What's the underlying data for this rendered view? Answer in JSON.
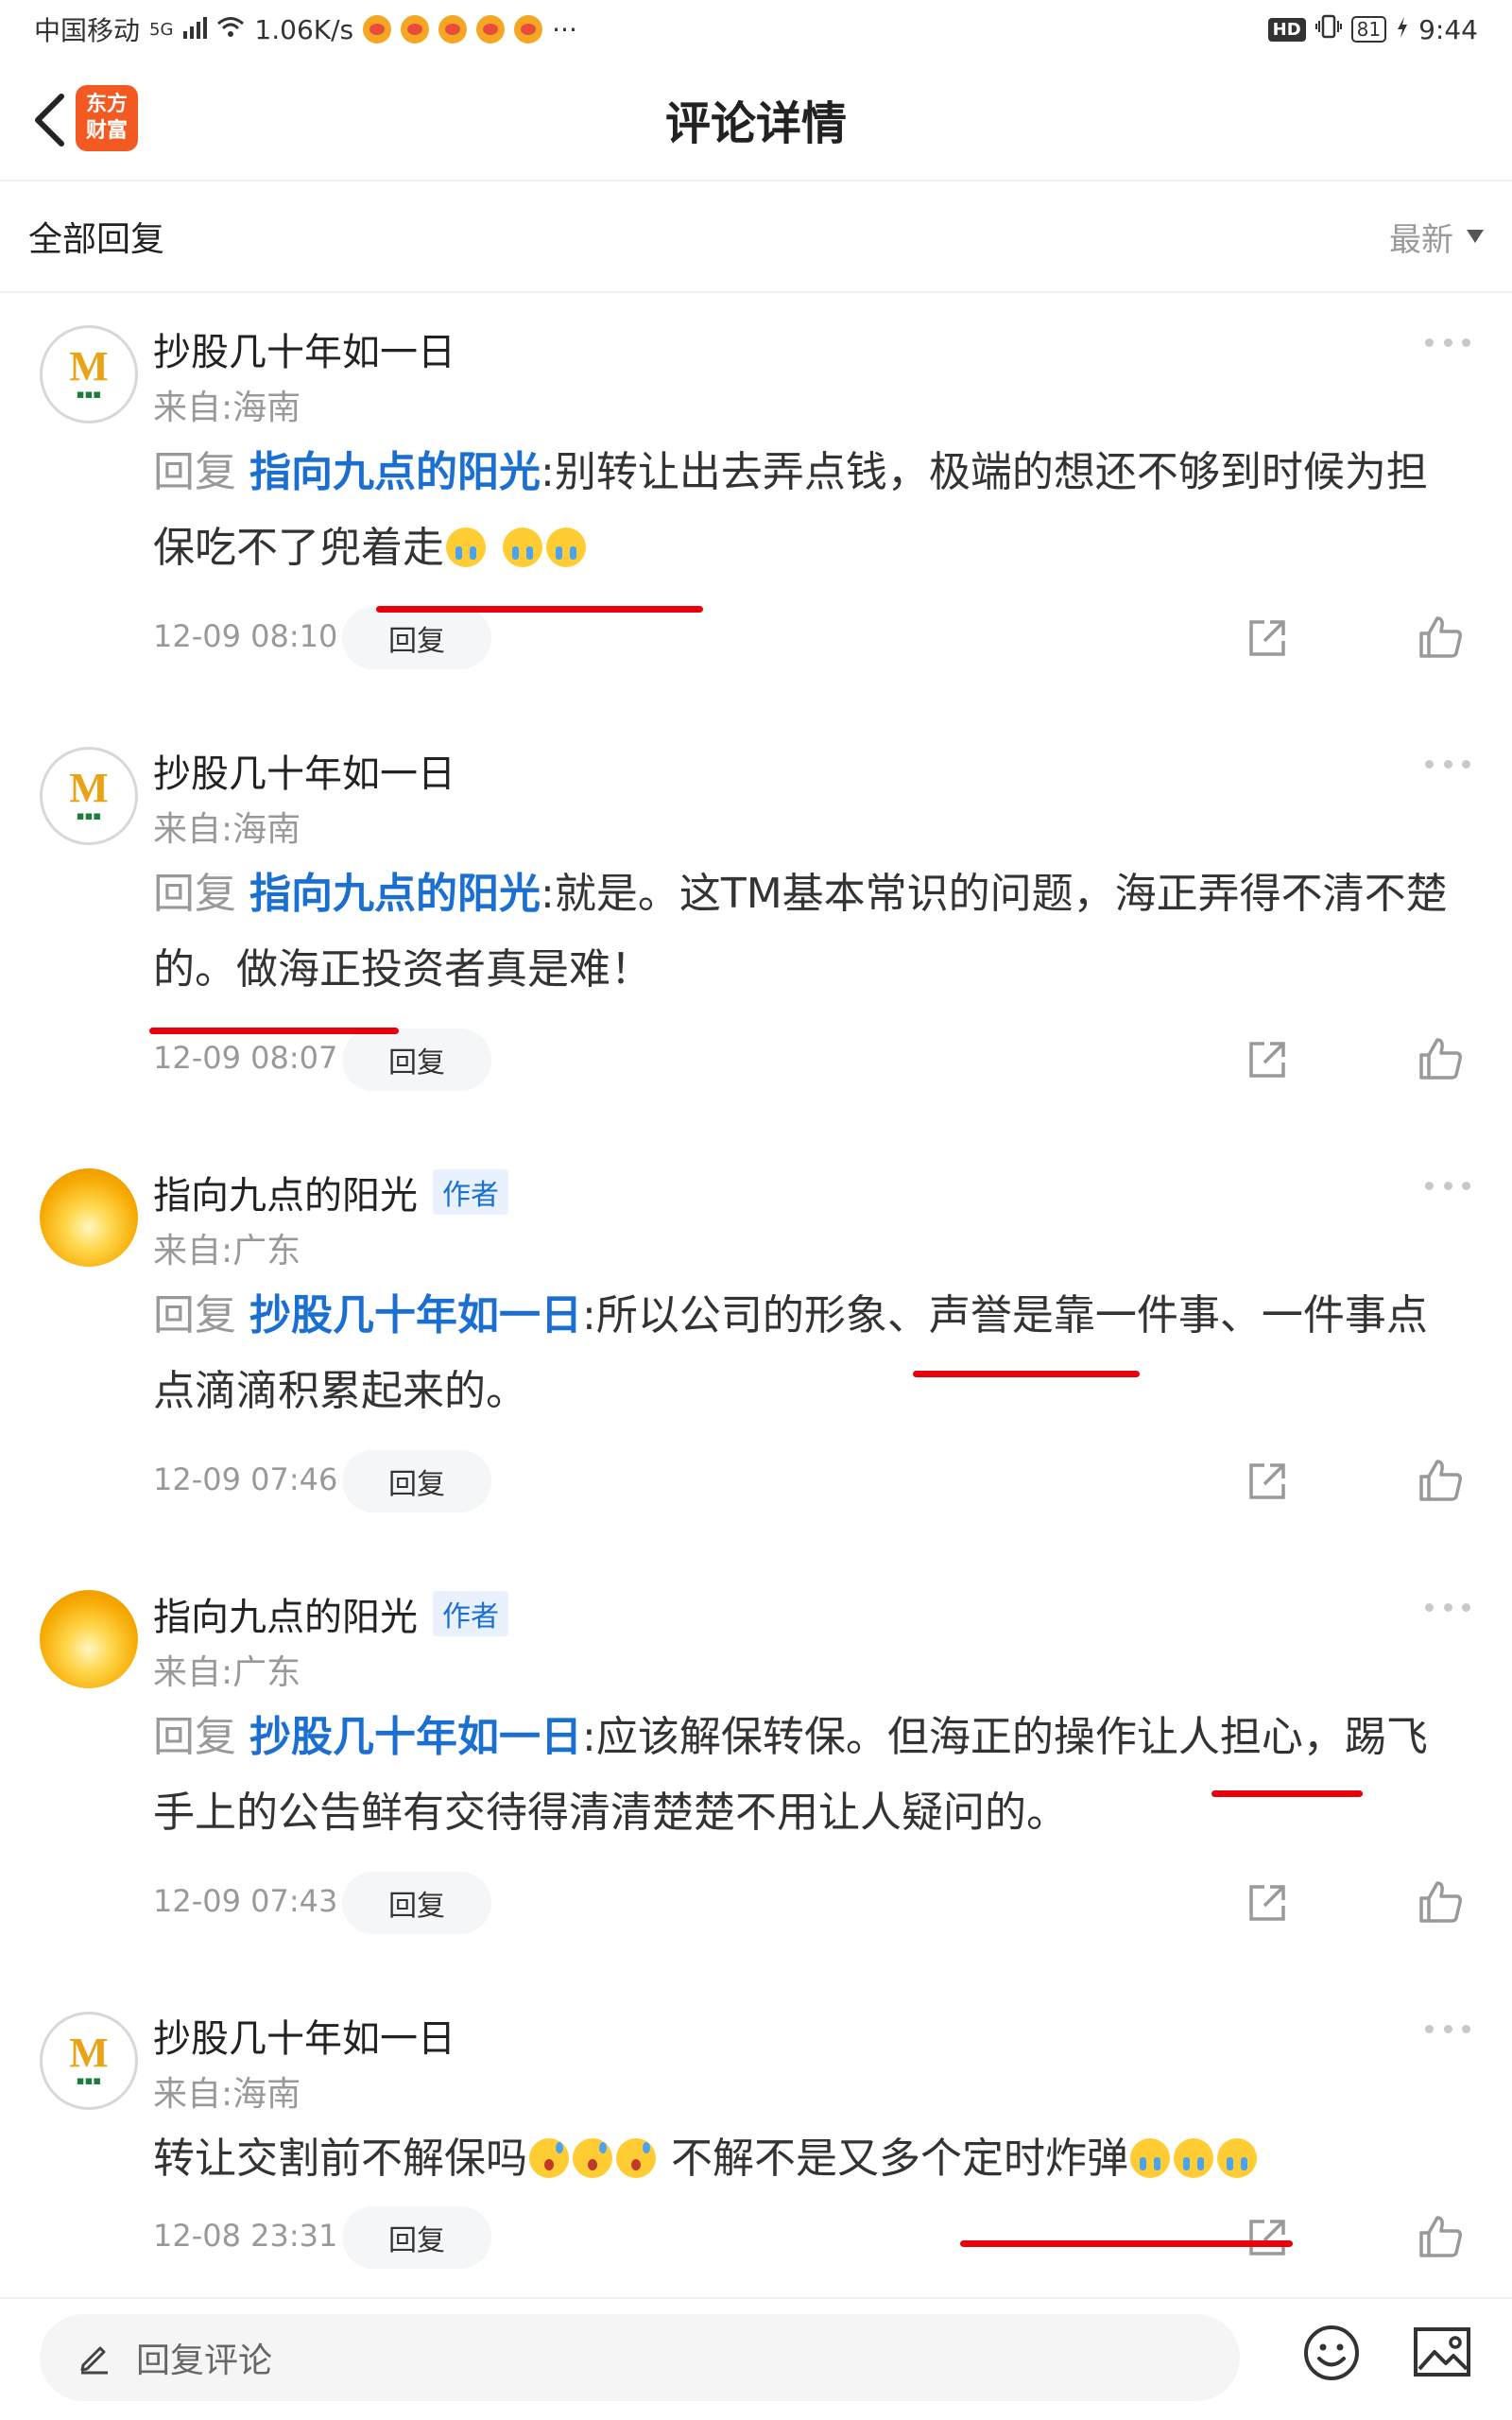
{
  "status_bar": {
    "carrier": "中国移动",
    "network": "5G",
    "speed": "1.06K/s",
    "more": "···",
    "hd": "HD",
    "battery": "81",
    "time": "9:44"
  },
  "header": {
    "title": "评论详情",
    "logo_line1": "东方",
    "logo_line2": "财富"
  },
  "filter": {
    "all_replies": "全部回复",
    "sort": "最新"
  },
  "comments": [
    {
      "username": "抄股几十年如一日",
      "author_tag": "",
      "location": "来自:海南",
      "reply_prefix": "回复",
      "reply_to": "指向九点的阳光",
      "separator": ":",
      "text_a": "别转让出去弄点钱，极端的想还不够到时候为担保吃不了兜着走",
      "text_b": "",
      "time": "12-09 08:10",
      "reply_label": "回复",
      "avatar": "m"
    },
    {
      "username": "抄股几十年如一日",
      "author_tag": "",
      "location": "来自:海南",
      "reply_prefix": "回复",
      "reply_to": "指向九点的阳光",
      "separator": ":",
      "text_a": "就是。这TM基本常识的问题，海正弄得不清不楚的。做海正投资者真是难！",
      "text_b": "",
      "time": "12-09 08:07",
      "reply_label": "回复",
      "avatar": "m"
    },
    {
      "username": "指向九点的阳光",
      "author_tag": "作者",
      "location": "来自:广东",
      "reply_prefix": "回复",
      "reply_to": "抄股几十年如一日",
      "separator": ":",
      "text_a": "所以公司的形象、声誉是靠一件事、一件事点点滴滴积累起来的。",
      "text_b": "",
      "time": "12-09 07:46",
      "reply_label": "回复",
      "avatar": "sun"
    },
    {
      "username": "指向九点的阳光",
      "author_tag": "作者",
      "location": "来自:广东",
      "reply_prefix": "回复",
      "reply_to": "抄股几十年如一日",
      "separator": ":",
      "text_a": "应该解保转保。但海正的操作让人担心，踢飞手上的公告鲜有交待得清清楚楚不用让人疑问的。",
      "text_b": "",
      "time": "12-09 07:43",
      "reply_label": "回复",
      "avatar": "sun"
    },
    {
      "username": "抄股几十年如一日",
      "author_tag": "",
      "location": "来自:海南",
      "reply_prefix": "",
      "reply_to": "",
      "separator": "",
      "text_a": "转让交割前不解保吗",
      "text_b": " 不解不是又多个定时炸弹",
      "time": "12-08 23:31",
      "reply_label": "回复",
      "avatar": "m"
    }
  ],
  "bottom_bar": {
    "placeholder": "回复评论"
  },
  "icons": {
    "back": "back-arrow-icon",
    "more": "more-dots-icon",
    "share": "share-icon",
    "like": "thumbs-up-icon",
    "pencil": "pencil-icon",
    "emoji": "emoji-icon",
    "image": "image-icon"
  },
  "colors": {
    "accent_blue": "#1a6fd1",
    "brand_orange": "#f25a22",
    "annotation_red": "#e8000b"
  }
}
